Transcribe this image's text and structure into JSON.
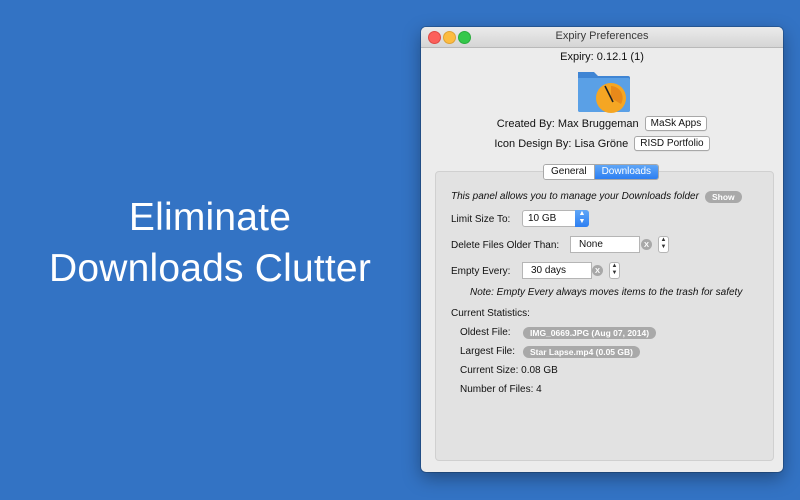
{
  "headline": {
    "line1": "Eliminate",
    "line2": "Downloads Clutter"
  },
  "window": {
    "title": "Expiry Preferences",
    "version": "Expiry: 0.12.1 (1)",
    "created_by_label": "Created By: Max Bruggeman",
    "created_by_button": "MaSk Apps",
    "icon_design_label": "Icon Design By: Lisa Gröne",
    "icon_design_button": "RISD Portfolio",
    "tabs": [
      {
        "label": "General",
        "selected": false
      },
      {
        "label": "Downloads",
        "selected": true
      }
    ]
  },
  "panel": {
    "info_text": "This panel allows you to manage your Downloads folder",
    "show_button": "Show",
    "limit_size_label": "Limit Size To:",
    "limit_size_value": "10 GB",
    "delete_older_label": "Delete Files Older Than:",
    "delete_older_value": "None",
    "empty_every_label": "Empty Every:",
    "empty_every_value": "30 days",
    "clear_glyph": "X",
    "note": "Note: Empty Every always moves items to the trash for safety",
    "stats_heading": "Current Statistics:",
    "oldest_file_label": "Oldest File:",
    "oldest_file_value": "IMG_0669.JPG (Aug 07, 2014)",
    "largest_file_label": "Largest File:",
    "largest_file_value": "Star Lapse.mp4 (0.05 GB)",
    "current_size": "Current Size: 0.08 GB",
    "number_of_files": "Number of Files: 4"
  },
  "colors": {
    "background": "#3373c4",
    "accent": "#2d7ff2",
    "folder": "#4a90d9",
    "clock": "#f5a623"
  },
  "icons": [
    "folder-clock-icon",
    "stepper-icon",
    "clear-icon",
    "popup-arrows-icon"
  ]
}
